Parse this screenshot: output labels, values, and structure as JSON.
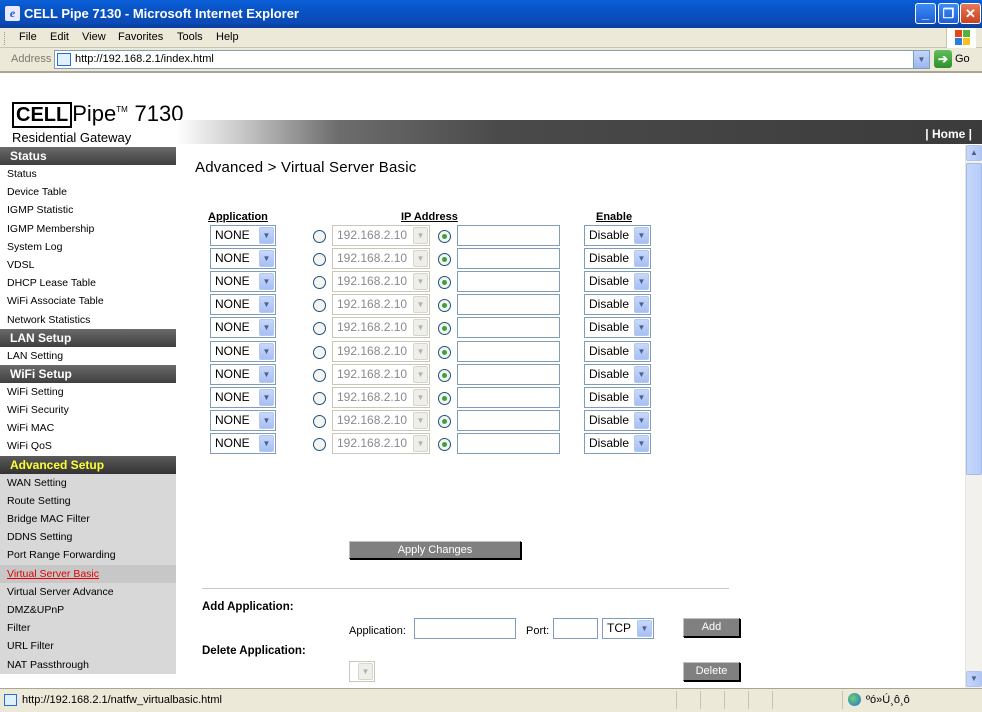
{
  "window": {
    "title": "CELL Pipe 7130 - Microsoft Internet Explorer"
  },
  "menu": [
    "File",
    "Edit",
    "View",
    "Favorites",
    "Tools",
    "Help"
  ],
  "address": {
    "label": "Address",
    "url": "http://192.168.2.1/index.html",
    "go": "Go"
  },
  "logo": {
    "brand_cell": "CELL",
    "brand_pipe": "Pipe",
    "tm": "TM",
    "model": "7130",
    "subtitle": "Residential Gateway"
  },
  "banner": {
    "home": "| Home |"
  },
  "sidebar": {
    "status_title": "Status",
    "status_items": [
      "Status",
      "Device Table",
      "IGMP Statistic",
      "IGMP Membership",
      "System Log",
      "VDSL",
      "DHCP Lease Table",
      "WiFi Associate Table",
      "Network Statistics"
    ],
    "lan_title": "LAN Setup",
    "lan_items": [
      "LAN Setting"
    ],
    "wifi_title": "WiFi Setup",
    "wifi_items": [
      "WiFi Setting",
      "WiFi Security",
      "WiFi MAC",
      "WiFi QoS"
    ],
    "adv_title": "Advanced Setup",
    "adv_items": [
      "WAN Setting",
      "Route Setting",
      "Bridge MAC Filter",
      "DDNS Setting",
      "Port Range Forwarding",
      "Virtual Server Basic",
      "Virtual Server Advance",
      "DMZ&UPnP",
      "Filter",
      "URL Filter",
      "NAT Passthrough"
    ],
    "active_item": "Virtual Server Basic"
  },
  "main": {
    "heading": "Advanced > Virtual Server Basic",
    "col_application": "Application",
    "col_ip": "IP Address",
    "col_enable": "Enable",
    "rows": [
      {
        "app": "NONE",
        "ip": "192.168.2.10",
        "enable": "Disable"
      },
      {
        "app": "NONE",
        "ip": "192.168.2.10",
        "enable": "Disable"
      },
      {
        "app": "NONE",
        "ip": "192.168.2.10",
        "enable": "Disable"
      },
      {
        "app": "NONE",
        "ip": "192.168.2.10",
        "enable": "Disable"
      },
      {
        "app": "NONE",
        "ip": "192.168.2.10",
        "enable": "Disable"
      },
      {
        "app": "NONE",
        "ip": "192.168.2.10",
        "enable": "Disable"
      },
      {
        "app": "NONE",
        "ip": "192.168.2.10",
        "enable": "Disable"
      },
      {
        "app": "NONE",
        "ip": "192.168.2.10",
        "enable": "Disable"
      },
      {
        "app": "NONE",
        "ip": "192.168.2.10",
        "enable": "Disable"
      },
      {
        "app": "NONE",
        "ip": "192.168.2.10",
        "enable": "Disable"
      }
    ],
    "apply_button": "Apply Changes",
    "add_title": "Add Application:",
    "app_label": "Application:",
    "port_label": "Port:",
    "protocol": "TCP",
    "add_button": "Add",
    "delete_title": "Delete Application:",
    "delete_button": "Delete"
  },
  "statusbar": {
    "url": "http://192.168.2.1/natfw_virtualbasic.html",
    "zone": "ºó»Ú¸ô¸ô"
  }
}
